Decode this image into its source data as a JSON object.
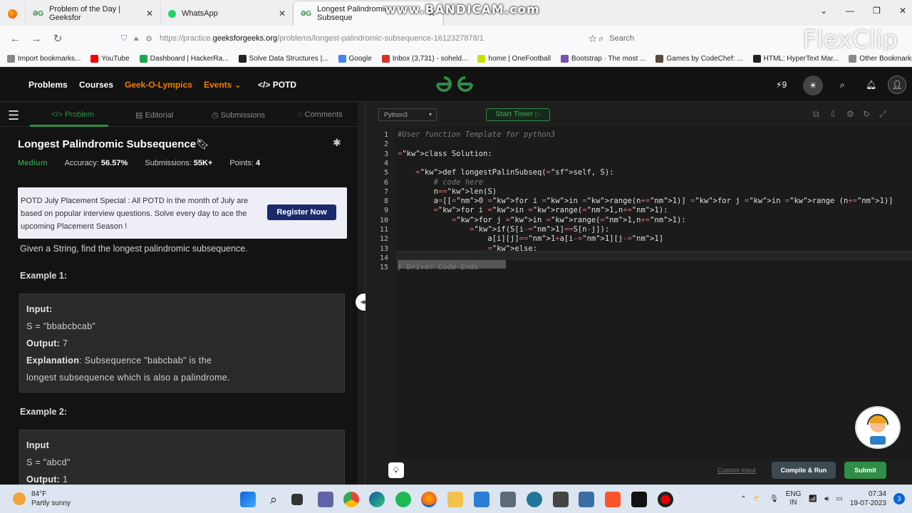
{
  "browser": {
    "tabs": [
      {
        "title": "Problem of the Day | Geeksfor"
      },
      {
        "title": "WhatsApp"
      },
      {
        "title": "Longest Palindromic Subseque"
      }
    ],
    "url_prefix": "https://practice.",
    "url_domain": "geeksforgeeks.org",
    "url_path": "/problems/longest-palindromic-subsequence-1612327878/1",
    "search_placeholder": "Search",
    "bookmarks": [
      {
        "label": "Import bookmarks...",
        "color": "#888888"
      },
      {
        "label": "YouTube",
        "color": "#ff0000"
      },
      {
        "label": "Dashboard | HackerRa...",
        "color": "#1ba94c"
      },
      {
        "label": "Solve Data Structures |...",
        "color": "#222222"
      },
      {
        "label": "Google",
        "color": "#4285f4"
      },
      {
        "label": "Inbox (3,731) - soheld...",
        "color": "#d93025"
      },
      {
        "label": "home | OneFootball",
        "color": "#c6e000"
      },
      {
        "label": "Bootstrap · The most ...",
        "color": "#7952b3"
      },
      {
        "label": "Games by CodeChef: ...",
        "color": "#5b4638"
      },
      {
        "label": "HTML: HyperText Mar...",
        "color": "#222222"
      },
      {
        "label": "Other Bookmarks",
        "color": "#888888"
      }
    ],
    "overlay_recorder": "www.BANDICAM.com",
    "overlay_flexclip": "FlexClip"
  },
  "gfg_header": {
    "links": [
      "Problems",
      "Courses",
      "Geek-O-Lympics",
      "Events",
      "POTD"
    ],
    "streak": "9"
  },
  "left_tabs": [
    "Problem",
    "Editorial",
    "Submissions",
    "Comments"
  ],
  "problem": {
    "title": "Longest Palindromic Subsequence",
    "difficulty": "Medium",
    "accuracy_label": "Accuracy:",
    "accuracy": "56.57%",
    "submissions_label": "Submissions:",
    "submissions": "55K+",
    "points_label": "Points:",
    "points": "4",
    "banner_text": "POTD July Placement Special : All POTD in the month of July are based on popular interview questions. Solve every day to ace the upcoming Placement Season !",
    "register_label": "Register Now",
    "statement": "Given a String, find the longest palindromic subsequence.",
    "example1_heading": "Example 1:",
    "example1": {
      "input_label": "Input:",
      "input_value": "S = \"bbabcbcab\"",
      "output_label": "Output:",
      "output_value": "7",
      "explanation_label": "Explanation",
      "explanation_line1": ": Subsequence \"babcbab\" is the",
      "explanation_line2": "longest subsequence which is also a palindrome."
    },
    "example2_heading": "Example 2:",
    "example2": {
      "input_label": "Input",
      "input_value": "S = \"abcd\"",
      "output_label": "Output:",
      "output_value": "1"
    }
  },
  "editor": {
    "language": "Python3",
    "timer_label": "Start Timer",
    "code_lines": [
      "#User function Template for python3",
      "",
      "class Solution:",
      "",
      "    def longestPalinSubseq(self, S):",
      "        # code here",
      "        n=len(S)",
      "        a=[[0 for i in range(n+1)] for j in range (n+1)]",
      "        for i in range(1,n+1):",
      "            for j in range(1,n+1):",
      "                if(S[i-1]==S[n-j]):",
      "                    a[i][j]=1+a[i-1][j-1]",
      "                    else:",
      "",
      "} Driver Code Ends"
    ],
    "custom_input_label": "Custom Input",
    "compile_label": "Compile & Run",
    "submit_label": "Submit"
  },
  "taskbar": {
    "temperature": "84°F",
    "weather": "Partly sunny",
    "lang1": "ENG",
    "lang2": "IN",
    "time": "07:34",
    "date": "19-07-2023"
  },
  "colors": {
    "gfg_green": "#2f8d46",
    "orange": "#f57c00",
    "register_blue": "#1a2a6c"
  }
}
